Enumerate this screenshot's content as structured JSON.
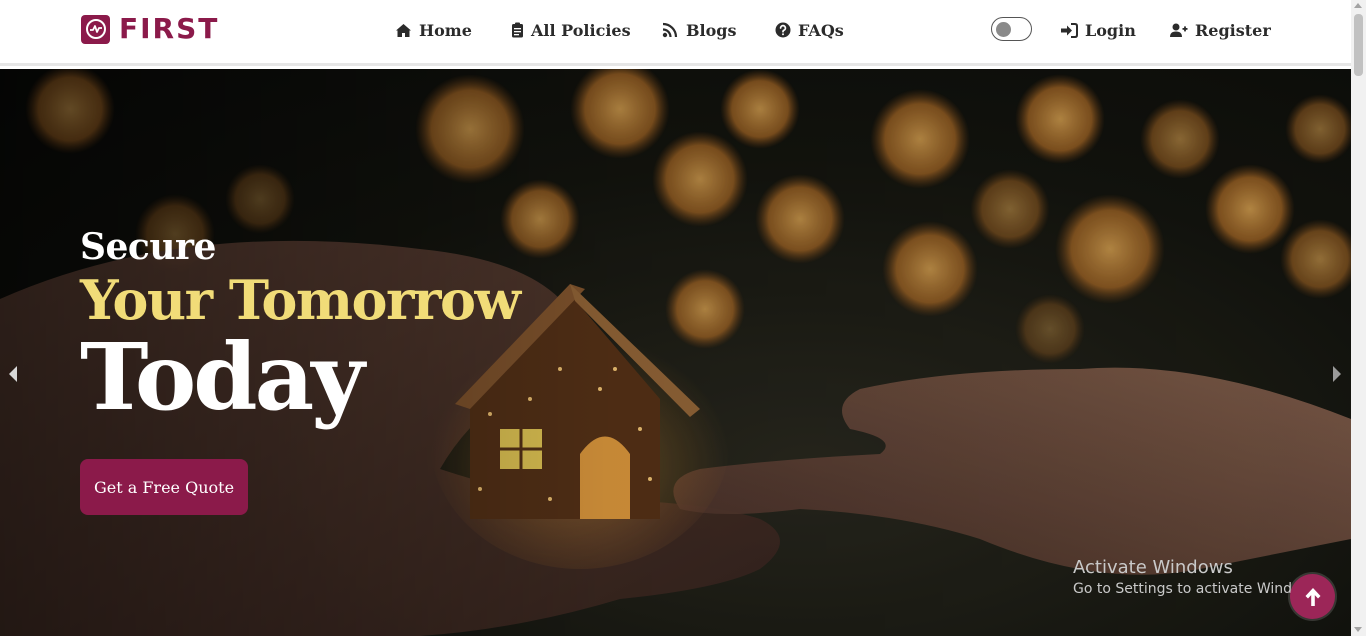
{
  "brand": {
    "name": "FIRST",
    "color": "#8b1a4a",
    "logo_icon": "pulse-logo-icon"
  },
  "nav": {
    "items": [
      {
        "label": "Home",
        "icon": "home-icon"
      },
      {
        "label": "All Policies",
        "icon": "clipboard-icon"
      },
      {
        "label": "Blogs",
        "icon": "rss-icon"
      },
      {
        "label": "FAQs",
        "icon": "question-circle-icon"
      }
    ],
    "theme_toggle": {
      "state": "off"
    },
    "login_label": "Login",
    "register_label": "Register"
  },
  "hero": {
    "line1": "Secure",
    "line2": "Your Tomorrow",
    "line3": "Today",
    "cta_label": "Get a Free Quote",
    "accent_color": "#f1dc78"
  },
  "watermark": {
    "title": "Activate Windows",
    "subtitle": "Go to Settings to activate Windows."
  }
}
